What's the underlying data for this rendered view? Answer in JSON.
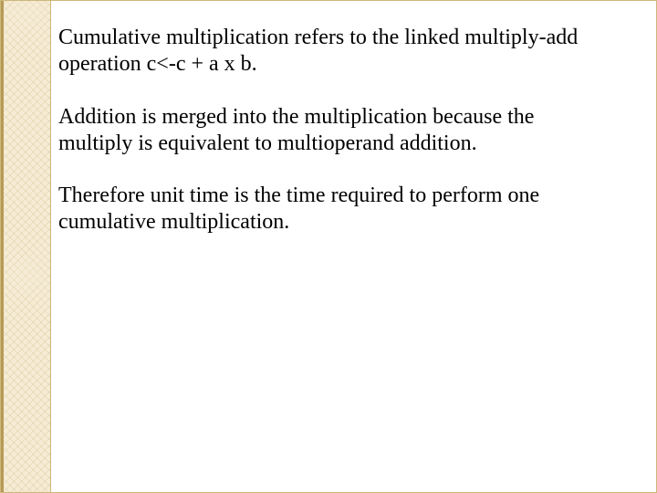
{
  "slide": {
    "paragraphs": [
      "Cumulative multiplication refers to the linked multiply-add operation c<-c + a x b.",
      "Addition is merged into the multiplication because the multiply is equivalent to multioperand addition.",
      "Therefore unit time is the time required to perform one cumulative multiplication."
    ]
  }
}
